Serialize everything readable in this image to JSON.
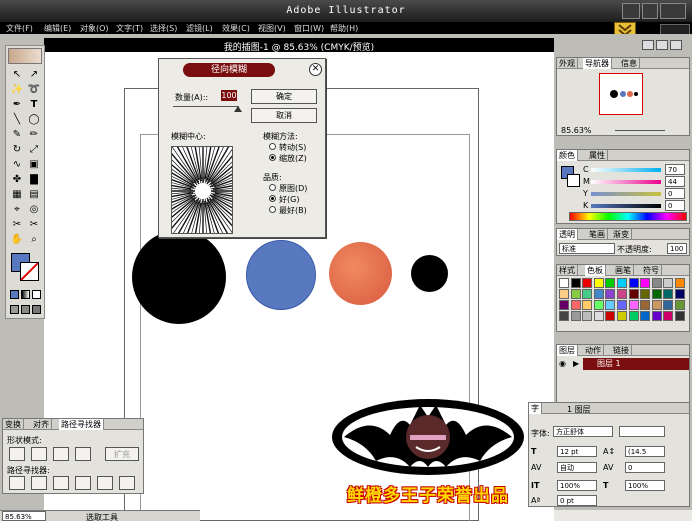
{
  "app": {
    "title": "Adobe Illustrator"
  },
  "menu": [
    "文件(F)",
    "编辑(E)",
    "对象(O)",
    "文字(T)",
    "选择(S)",
    "滤镜(L)",
    "效果(C)",
    "视图(V)",
    "窗口(W)",
    "帮助(H)"
  ],
  "document": {
    "title": "我的插图-1 @ 85.63% (CMYK/预览)"
  },
  "dialog": {
    "title": "径向模糊",
    "amount_label": "数量(A)::",
    "amount_value": "100",
    "ok": "确定",
    "cancel": "取消",
    "center_label": "模糊中心:",
    "method_label": "模糊方法:",
    "method_options": [
      "转动(S)",
      "缩放(Z)"
    ],
    "quality_label": "品质:",
    "quality_options": [
      "原图(D)",
      "好(G)",
      "最好(B)"
    ]
  },
  "navigator": {
    "tabs": [
      "外观",
      "导航器",
      "信息"
    ],
    "zoom": "85.63%"
  },
  "color": {
    "tabs": [
      "颜色",
      "属性"
    ],
    "channels": [
      {
        "label": "C",
        "value": "70",
        "unit": "%"
      },
      {
        "label": "M",
        "value": "44",
        "unit": "%"
      },
      {
        "label": "Y",
        "value": "0",
        "unit": "%"
      },
      {
        "label": "K",
        "value": "0",
        "unit": "%"
      }
    ]
  },
  "transparency": {
    "tabs": [
      "透明",
      "笔画",
      "渐变"
    ],
    "mode": "标准",
    "opacity_label": "不透明度:",
    "opacity": "100"
  },
  "swatches": {
    "tabs": [
      "样式",
      "色板",
      "画笔",
      "符号"
    ]
  },
  "layers": {
    "tabs": [
      "图层",
      "动作",
      "链接"
    ],
    "layer_name": "图层 1",
    "count": "1 图层"
  },
  "pathfinder": {
    "tabs": [
      "变换",
      "对齐",
      "路径寻找器"
    ],
    "shape_modes": "形状模式:",
    "expand": "扩充",
    "pathfinders": "路径寻找器:"
  },
  "character": {
    "tab": "字",
    "font_label": "字体:",
    "font": "方正舒体",
    "size": "12 pt",
    "leading": "(14.5",
    "tracking": "自动",
    "kerning": "0",
    "hscale": "100%",
    "vscale": "100%",
    "baseline": "0 pt"
  },
  "status": {
    "zoom": "85.63%",
    "tool": "选取工具"
  },
  "watermark": {
    "text": "鲜橙多王子荣誉出品"
  },
  "colors": {
    "blue_circle": "#5878c0",
    "orange_circle": "#e06a48",
    "accent_red": "#7a0e0e"
  }
}
